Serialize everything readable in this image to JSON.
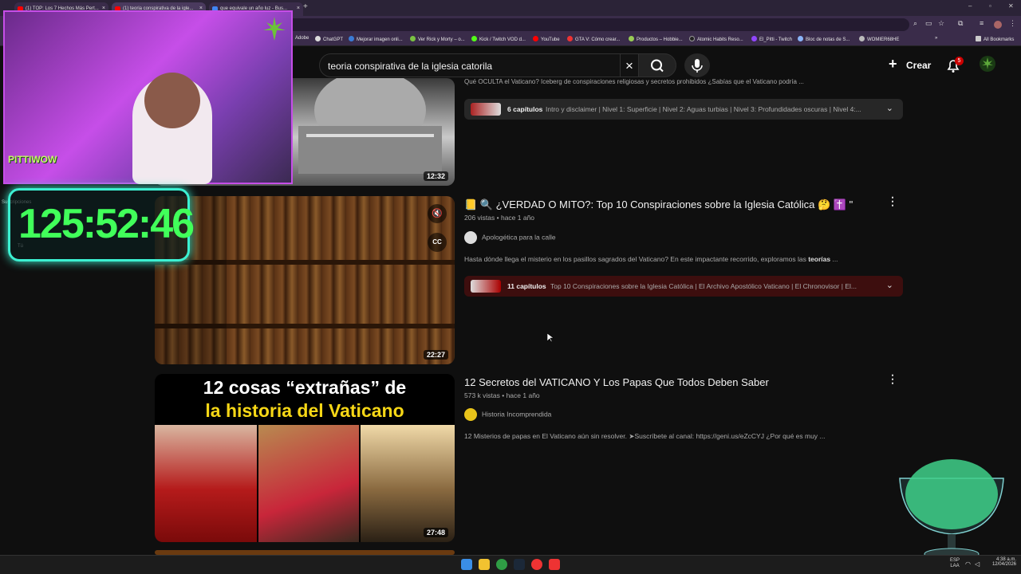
{
  "browser": {
    "tabs": [
      {
        "label": "(1) TOP: Los 7 Hechos Más Pert..."
      },
      {
        "label": "(1) teoria conspirativa de la igle..."
      },
      {
        "label": "que equivale un año luz - Bus..."
      }
    ],
    "new_tab_label": "+",
    "bookmarks": [
      {
        "label": "Adobe"
      },
      {
        "label": "ChatGPT"
      },
      {
        "label": "Mejorar imagen onli..."
      },
      {
        "label": "Ver Rick y Morty – o..."
      },
      {
        "label": "Kick / Twitch VOD d..."
      },
      {
        "label": "YouTube"
      },
      {
        "label": "GTA V: Cómo crear..."
      },
      {
        "label": "Productos – Hobbie..."
      },
      {
        "label": "Atomic Habits Reso..."
      },
      {
        "label": "El_Pitti - Twitch"
      },
      {
        "label": "Bloc de notas de S..."
      },
      {
        "label": "WOMIER68HE"
      }
    ],
    "bookmarks_more": "»",
    "all_bookmarks": "All Bookmarks"
  },
  "youtube": {
    "search_query": "teoria conspirativa de la iglesia catorila",
    "clear_icon": "×",
    "create_label": "Crear",
    "notification_count": "5"
  },
  "results": [
    {
      "partial_desc": "Qué OCULTA el Vaticano? Iceberg de conspiraciones religiosas y secretos prohibidos ¿Sabías que el Vaticano podría ...",
      "duration": "12:32",
      "chapters_count": "6 capítulos",
      "chapters_list": "Intro y disclaimer | Nivel 1: Superficie | Nivel 2: Aguas turbias | Nivel 3: Profundidades oscuras | Nivel 4:..."
    },
    {
      "title": "📒 🔍 ¿VERDAD O MITO?: Top 10 Conspiraciones sobre la Iglesia Católica 🤔 ✝️ \"",
      "views": "206 vistas • hace 1 año",
      "channel": "Apologética para la calle",
      "desc_plain": "Hasta dónde llega el misterio en los pasillos sagrados del Vaticano? En este impactante recorrido, exploramos las ",
      "desc_bold": "teorías",
      "desc_tail": " ...",
      "duration": "22:27",
      "chapters_count": "11 capítulos",
      "chapters_list": "Top 10 Conspiraciones sobre la Iglesia Católica | El Archivo Apostólico Vaticano | El Chronovisor | El..."
    },
    {
      "title": "12 Secretos del VATICANO Y Los Papas Que Todos Deben Saber",
      "views": "573 k vistas • hace 1 año",
      "channel": "Historia Incomprendida",
      "desc": "12 Misterios de papas en El Vaticano aún sin resolver. ➤Suscríbete al canal: https://geni.us/eZcCYJ ¿Por qué es muy ...",
      "thumb_line1": "12 cosas “extrañas” de",
      "thumb_line2": "la historia del  Vaticano",
      "duration": "27:48"
    }
  ],
  "overlay": {
    "timer": "125:52:46",
    "cam_brand": "PITTIWOW",
    "subscriptions_label": "Suscripciones",
    "tu_label": "Tú"
  },
  "taskbar": {
    "lang": "ESP",
    "region": "LAA",
    "time": "4:38 a.m.",
    "date": "12/04/2026"
  }
}
